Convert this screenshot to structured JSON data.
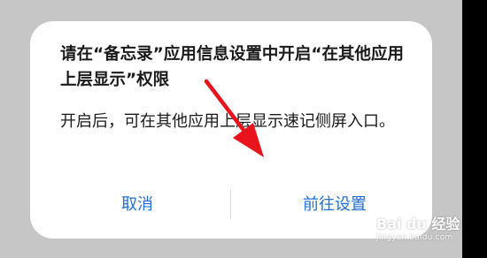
{
  "dialog": {
    "title": "请在“备忘录”应用信息设置中开启“在其他应用上层显示”权限",
    "message": "开启后，可在其他应用上层显示速记侧屏入口。",
    "cancel_label": "取消",
    "confirm_label": "前往设置"
  },
  "watermark": {
    "brand": "Bai du 经验",
    "url": "jingyan.baidu.com",
    "icon": "paw-icon"
  },
  "annotation": {
    "icon": "red-arrow-icon",
    "color": "#e8131b"
  },
  "colors": {
    "backdrop": "#c6c6c6",
    "dialog_background": "#ffffff",
    "button_text": "#1f6fd6"
  }
}
